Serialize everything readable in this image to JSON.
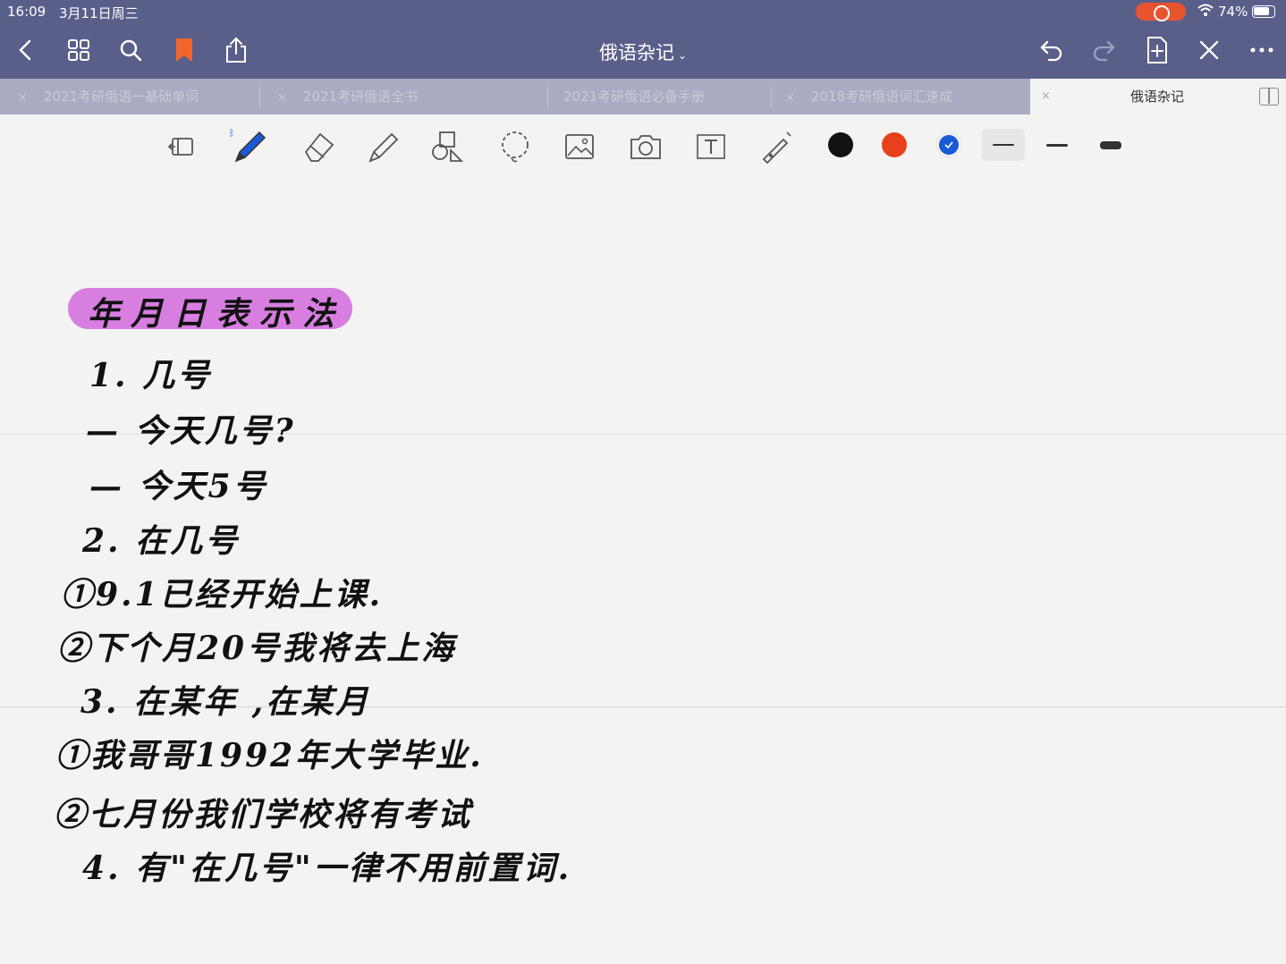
{
  "status": {
    "time": "16:09",
    "date": "3月11日周三",
    "battery": "74%",
    "rec_color": "#e8542e"
  },
  "nav": {
    "title": "俄语杂记",
    "icons": [
      "back-icon",
      "grid-icon",
      "search-icon",
      "bookmark-icon",
      "share-icon",
      "undo-icon",
      "redo-icon",
      "add-page-icon",
      "close-icon",
      "more-icon"
    ],
    "bookmark_color": "#f0662c"
  },
  "tabs": [
    {
      "label": "2021考研俄语一基础单词",
      "active": false
    },
    {
      "label": "2021考研俄语全书",
      "active": false
    },
    {
      "label": "2021考研俄语必备手册",
      "active": false
    },
    {
      "label": "2018考研俄语词汇速成",
      "active": false
    },
    {
      "label": "俄语杂记",
      "active": true
    }
  ],
  "toolbar": {
    "tools": [
      "reading-mode-icon",
      "pen-icon",
      "eraser-icon",
      "highlighter-icon",
      "shapes-icon",
      "lasso-icon",
      "image-icon",
      "camera-icon",
      "text-icon",
      "laser-pointer-icon"
    ],
    "colors": [
      "#111111",
      "#e8401c",
      "#1a5ad6"
    ],
    "selected_color": 2,
    "stroke_widths": [
      "thin",
      "medium",
      "thick"
    ],
    "selected_stroke": 0
  },
  "note": {
    "heading": "年月日表示法",
    "heading_highlight": "#d77ee0",
    "lines": [
      "1. 几号",
      "— 今天几号?",
      "— 今天5号",
      "2. 在几号",
      "①9.1已经开始上课.",
      "②下个月20号我将去上海",
      "3. 在某年 ,在某月",
      "①我哥哥1992年大学毕业.",
      "②七月份我们学校将有考试",
      "4. 有\"在几号\"一律不用前置词."
    ]
  }
}
